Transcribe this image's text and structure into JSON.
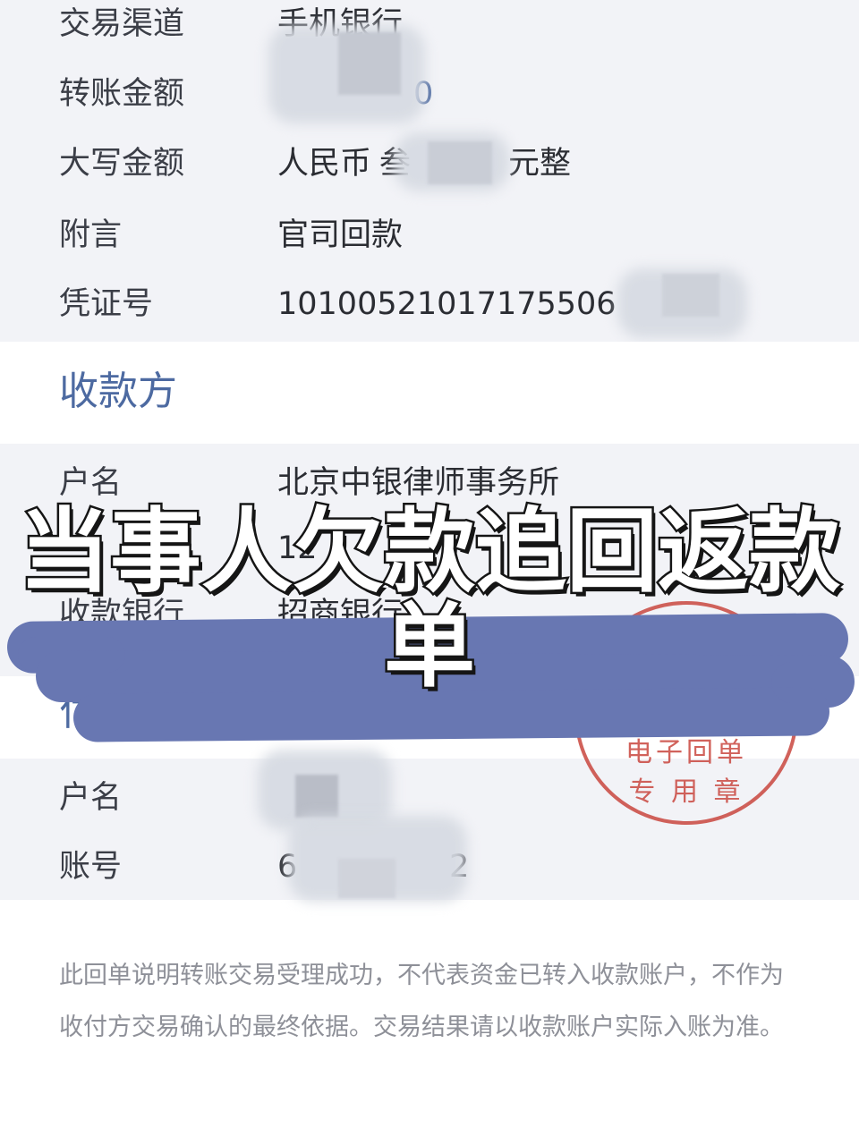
{
  "transaction": {
    "channel_label": "交易渠道",
    "channel_value": "手机银行",
    "amount_label": "转账金额",
    "amount_value_visible": "0",
    "amount_caps_label": "大写金额",
    "amount_caps_prefix": "人民币",
    "amount_caps_partial": "叁",
    "amount_caps_suffix": "元整",
    "memo_label": "附言",
    "memo_value": "官司回款",
    "voucher_label": "凭证号",
    "voucher_value": "10100521017175506"
  },
  "payee": {
    "section_title": "收款方",
    "name_label": "户名",
    "name_value": "北京中银律师事务所",
    "account_partial": "12",
    "bank_label": "收款银行",
    "bank_value": "招商银行"
  },
  "payer": {
    "section_title": "付款方",
    "name_label": "户名",
    "account_label": "账号",
    "account_start": "6",
    "account_end": "2"
  },
  "stamp": {
    "line1": "电子回单",
    "line2": "专 用 章",
    "color": "#c9473f"
  },
  "overlay": {
    "headline_line1": "当事人欠款追回返款",
    "headline_line2": "单",
    "brush_color": "#6877b2"
  },
  "footer_note": "此回单说明转账交易受理成功，不代表资金已转入收款账户，不作为收付方交易确认的最终依据。交易结果请以收款账户实际入账为准。"
}
